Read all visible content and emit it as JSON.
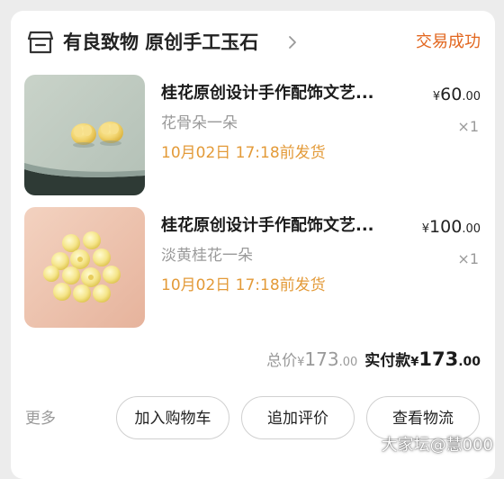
{
  "shop": {
    "name": "有良致物 原创手工玉石",
    "status": "交易成功"
  },
  "items": [
    {
      "title": "桂花原创设计手作配饰文艺...",
      "price_currency": "¥",
      "price_int": "60",
      "price_dec": ".00",
      "spec": "花骨朵一朵",
      "qty": "×1",
      "ship": "10月02日 17:18前发货"
    },
    {
      "title": "桂花原创设计手作配饰文艺...",
      "price_currency": "¥",
      "price_int": "100",
      "price_dec": ".00",
      "spec": "淡黄桂花一朵",
      "qty": "×1",
      "ship": "10月02日 17:18前发货"
    }
  ],
  "summary": {
    "total_label": "总价",
    "total_currency": "¥",
    "total_int": "173",
    "total_dec": ".00",
    "paid_label": "实付款",
    "paid_currency": "¥",
    "paid_int": "173",
    "paid_dec": ".00"
  },
  "actions": {
    "more": "更多",
    "add_to_cart": "加入购物车",
    "add_review": "追加评价",
    "view_logistics": "查看物流"
  },
  "watermark": "大家坛@慧000",
  "colors": {
    "status": "#e2661e",
    "ship": "#e39a38",
    "muted": "#9a9a9a"
  }
}
